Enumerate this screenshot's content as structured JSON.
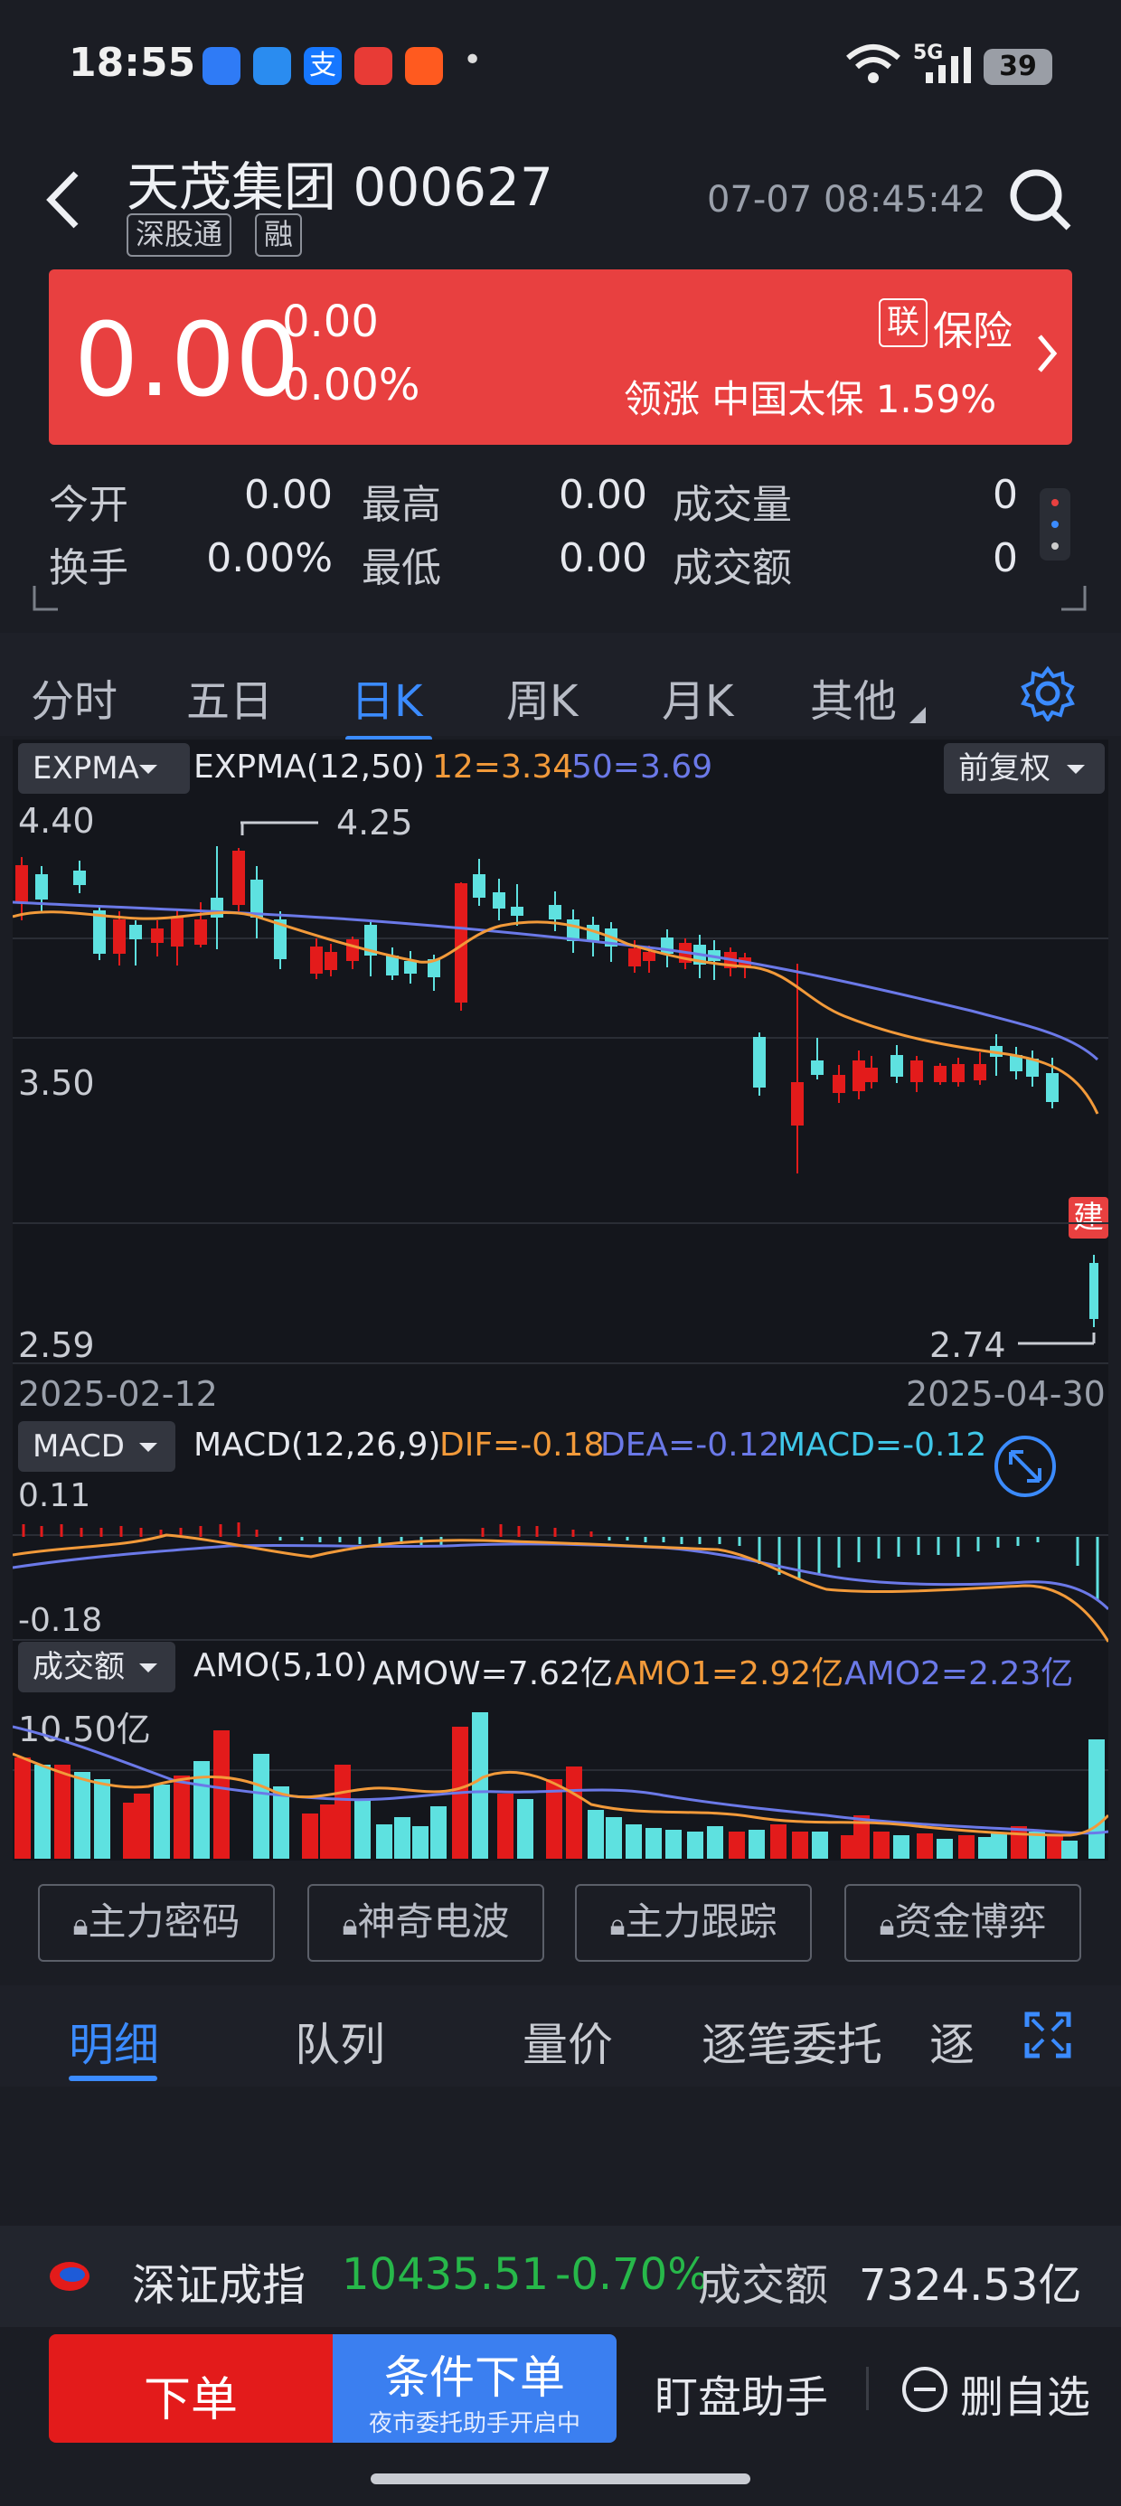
{
  "status_bar": {
    "time": "18:55",
    "app_icons": [
      "baidu-netdisk-icon",
      "alipay-helper-icon",
      "alipay-icon",
      "toutiao-icon",
      "video-app-icon"
    ],
    "notification_dot": "•",
    "network": "5G",
    "battery": "39"
  },
  "header": {
    "back_icon": "chevron-left-icon",
    "title": "天茂集团 000627",
    "tags": [
      "深股通",
      "融"
    ],
    "datetime": "07-07 08:45:42",
    "search_icon": "search-icon"
  },
  "quote": {
    "price": "0.00",
    "change": "0.00",
    "change_pct": "0.00%",
    "sector_badge": "联",
    "sector": "保险",
    "leader_text": "领涨 中国太保 1.59%",
    "card_color": "#e84040"
  },
  "stats": {
    "row1": [
      {
        "label": "今开",
        "value": "0.00"
      },
      {
        "label": "最高",
        "value": "0.00"
      },
      {
        "label": "成交量",
        "value": "0"
      }
    ],
    "row2": [
      {
        "label": "换手",
        "value": "0.00%"
      },
      {
        "label": "最低",
        "value": "0.00"
      },
      {
        "label": "成交额",
        "value": "0"
      }
    ]
  },
  "period_tabs": {
    "items": [
      "分时",
      "五日",
      "日K",
      "周K",
      "月K",
      "其他"
    ],
    "active": "日K",
    "settings_icon": "gear-icon"
  },
  "kline": {
    "indicator_select": "EXPMA",
    "indicator_name": "EXPMA(12,50)",
    "ema12": "12=3.34",
    "ema50": "50=3.69",
    "adjust_select": "前复权",
    "y_top": "4.40",
    "y_mid": "3.50",
    "y_bottom": "2.59",
    "high_mark": "4.25",
    "low_mark": "2.74",
    "date_start": "2025-02-12",
    "date_end": "2025-04-30",
    "build_badge": "建"
  },
  "macd": {
    "select": "MACD",
    "name": "MACD(12,26,9)",
    "dif": "DIF=-0.18",
    "dea": "DEA=-0.12",
    "macd": "MACD=-0.12",
    "y_top": "0.11",
    "y_bottom": "-0.18",
    "expand_icon": "expand-arrows-icon"
  },
  "amount": {
    "select": "成交额",
    "name": "AMO(5,10)",
    "amow": "AMOW=7.62亿",
    "amo1": "AMO1=2.92亿",
    "amo2": "AMO2=2.23亿",
    "y_top": "10.50亿"
  },
  "locked_tools": [
    "主力密码",
    "神奇电波",
    "主力跟踪",
    "资金博弈"
  ],
  "detail_tabs": {
    "items": [
      "明细",
      "队列",
      "量价",
      "逐笔委托",
      "逐"
    ],
    "active": "明细",
    "fullscreen_icon": "fullscreen-icon"
  },
  "index_bar": {
    "name": "深证成指",
    "value": "10435.51",
    "change_pct": "-0.70%",
    "amount_label": "成交额",
    "amount": "7324.53亿"
  },
  "actions": {
    "order": "下单",
    "conditional_order": "条件下单",
    "conditional_sub": "夜市委托助手开启中",
    "monitor": "盯盘助手",
    "remove_watch": "删自选"
  },
  "colors": {
    "up": "#e31b1b",
    "down": "#5ee1e0",
    "ema12": "#f29a3a",
    "ema50": "#6b79e8",
    "accent": "#3b8bff",
    "index_green": "#27b84a"
  }
}
